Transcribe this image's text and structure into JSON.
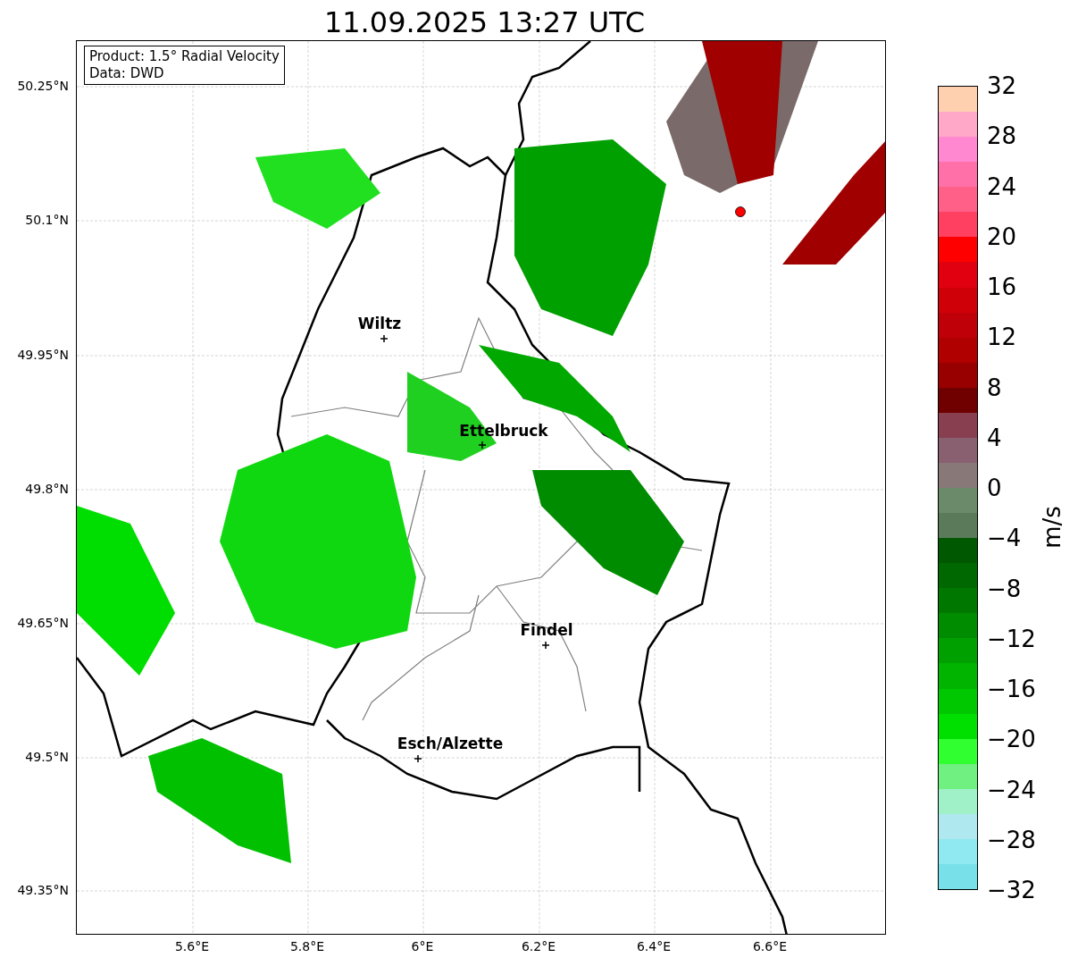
{
  "title": "11.09.2025 13:27 UTC",
  "legend": [
    "Product: 1.5° Radial Velocity",
    "Data: DWD"
  ],
  "y_ticks": [
    "50.25°N",
    "50.1°N",
    "49.95°N",
    "49.8°N",
    "49.65°N",
    "49.5°N",
    "49.35°N"
  ],
  "x_ticks": [
    "5.6°E",
    "5.8°E",
    "6°E",
    "6.2°E",
    "6.4°E",
    "6.6°E"
  ],
  "cities": [
    {
      "name": "Wiltz"
    },
    {
      "name": "Ettelbruck"
    },
    {
      "name": "Findel"
    },
    {
      "name": "Esch/Alzette"
    }
  ],
  "colorbar": {
    "label": "m/s",
    "ticks": [
      "32",
      "28",
      "24",
      "20",
      "16",
      "12",
      "8",
      "4",
      "0",
      "−4",
      "−8",
      "−12",
      "−16",
      "−20",
      "−24",
      "−28",
      "−32"
    ],
    "bands": [
      {
        "color": "#ffd0b0"
      },
      {
        "color": "#ffa8c8"
      },
      {
        "color": "#ff88d0"
      },
      {
        "color": "#ff70a8"
      },
      {
        "color": "#ff6088"
      },
      {
        "color": "#ff4060"
      },
      {
        "color": "#ff0000"
      },
      {
        "color": "#e00010"
      },
      {
        "color": "#d00008"
      },
      {
        "color": "#c00008"
      },
      {
        "color": "#b00000"
      },
      {
        "color": "#980000"
      },
      {
        "color": "#700000"
      },
      {
        "color": "#884050"
      },
      {
        "color": "#886070"
      },
      {
        "color": "#887878"
      },
      {
        "color": "#6a8a6a"
      },
      {
        "color": "#5a7a5a"
      },
      {
        "color": "#005800"
      },
      {
        "color": "#006800"
      },
      {
        "color": "#007800"
      },
      {
        "color": "#008c00"
      },
      {
        "color": "#00a000"
      },
      {
        "color": "#00b400"
      },
      {
        "color": "#00c800"
      },
      {
        "color": "#00e000"
      },
      {
        "color": "#30ff30"
      },
      {
        "color": "#70f080"
      },
      {
        "color": "#a0f0c8"
      },
      {
        "color": "#b0e8f0"
      },
      {
        "color": "#90e8f0"
      },
      {
        "color": "#78e0e8"
      }
    ]
  }
}
